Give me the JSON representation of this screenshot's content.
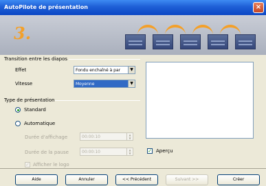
{
  "window": {
    "title": "AutoPilote de présentation",
    "close_glyph": "×"
  },
  "banner": {
    "step_number": "3."
  },
  "transition": {
    "section_label": "Transition entre les diapos",
    "effect_label": "Effet",
    "effect_value": "Fondu enchaîné à par",
    "speed_label": "Vitesse",
    "speed_value": "Moyenne"
  },
  "presentation_type": {
    "section_label": "Type de présentation",
    "standard_label": "Standard",
    "automatic_label": "Automatique",
    "page_duration_label": "Durée d'affichage",
    "page_duration_value": "00:00:10",
    "pause_duration_label": "Durée de la pause",
    "pause_duration_value": "00:00:10",
    "show_logo_label": "Afficher le logo"
  },
  "preview": {
    "label": "Aperçu"
  },
  "buttons": {
    "help": "Aide",
    "cancel": "Annuler",
    "previous": "<< Précédent",
    "next": "Suivant >>",
    "create": "Créer"
  },
  "icons": {
    "dropdown": "▼",
    "spin_up": "▲",
    "spin_down": "▼",
    "check": "✓"
  }
}
